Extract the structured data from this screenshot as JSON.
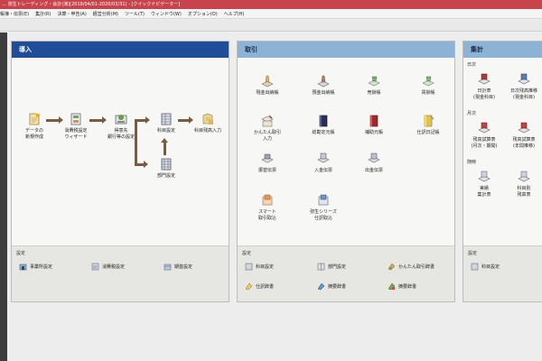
{
  "titlebar": {
    "text": "… 弥生トレーディング・会計(演)[2018/04/01-2020/03/31] - [クイックナビゲーター]"
  },
  "menu": [
    "帳簿・伝票(E)",
    "集計(R)",
    "決算・申告(A)",
    "経営分析(M)",
    "ツール(T)",
    "ウィンドウ(W)",
    "オプション(O)",
    "ヘルプ(H)"
  ],
  "panels": {
    "intro": {
      "title": "導入",
      "items": [
        {
          "label": "データの\n新規作成",
          "icon": "new-data-icon"
        },
        {
          "label": "消費税設定\nウィザード",
          "icon": "tax-wizard-icon"
        },
        {
          "label": "得意先\n銀行等の設定",
          "icon": "client-setup-icon"
        },
        {
          "label": "科目設定",
          "icon": "account-setup-icon"
        },
        {
          "label": "科目残高入力",
          "icon": "balance-input-icon"
        },
        {
          "label": "部門設定",
          "icon": "department-setup-icon"
        }
      ],
      "settings_label": "設定",
      "settings": [
        {
          "label": "事業所設定",
          "icon": "office-settings-icon"
        },
        {
          "label": "消費税設定",
          "icon": "tax-settings-icon"
        },
        {
          "label": "期首設定",
          "icon": "period-settings-icon"
        }
      ]
    },
    "trade": {
      "title": "取引",
      "items": [
        {
          "label": "現金出納帳",
          "icon": "cash-book-icon"
        },
        {
          "label": "預金出納帳",
          "icon": "deposit-book-icon"
        },
        {
          "label": "売掛帳",
          "icon": "receivables-icon"
        },
        {
          "label": "買掛帳",
          "icon": "payables-icon"
        },
        {
          "label": "かんたん取引\n入力",
          "icon": "easy-entry-icon"
        },
        {
          "label": "総勘定元帳",
          "icon": "general-ledger-icon"
        },
        {
          "label": "補助元帳",
          "icon": "sub-ledger-icon"
        },
        {
          "label": "仕訳日記帳",
          "icon": "journal-icon"
        },
        {
          "label": "振替伝票",
          "icon": "transfer-slip-icon"
        },
        {
          "label": "入金伝票",
          "icon": "receipt-slip-icon"
        },
        {
          "label": "出金伝票",
          "icon": "payment-slip-icon"
        },
        {
          "label": "スマート\n取引取込",
          "icon": "smart-import-icon"
        },
        {
          "label": "弥生シリーズ\n仕訳取込",
          "icon": "series-import-icon"
        }
      ],
      "settings_label": "設定",
      "settings": [
        {
          "label": "科目設定",
          "icon": "account-settings-icon"
        },
        {
          "label": "部門設定",
          "icon": "department-settings-icon"
        },
        {
          "label": "かんたん取引辞書",
          "icon": "easy-dictionary-icon"
        },
        {
          "label": "仕訳辞書",
          "icon": "journal-dictionary-icon"
        },
        {
          "label": "摘要辞書",
          "icon": "summary-dictionary-icon"
        },
        {
          "label": "摘要辞書",
          "icon": "summary-dictionary-icon-2"
        }
      ]
    },
    "total": {
      "title": "集計",
      "sections": [
        {
          "label": "日次",
          "items": [
            {
              "label": "日計表\n(現金科目)",
              "icon": "daily-table-icon"
            },
            {
              "label": "日次残高推移\n(現金科目)",
              "icon": "daily-balance-icon"
            }
          ]
        },
        {
          "label": "月次",
          "items": [
            {
              "label": "残高試算表\n(月次・期間)",
              "icon": "trial-balance-icon"
            },
            {
              "label": "残高試算表\n(年間推移)",
              "icon": "annual-trend-icon"
            }
          ]
        },
        {
          "label": "随時",
          "items": [
            {
              "label": "実績\n集計表",
              "icon": "summary-table-icon"
            },
            {
              "label": "科目別\n残高表",
              "icon": "account-balance-icon"
            }
          ]
        }
      ],
      "settings_label": "設定",
      "settings": [
        {
          "label": "科目設定",
          "icon": "account-settings-icon-2"
        }
      ]
    }
  }
}
